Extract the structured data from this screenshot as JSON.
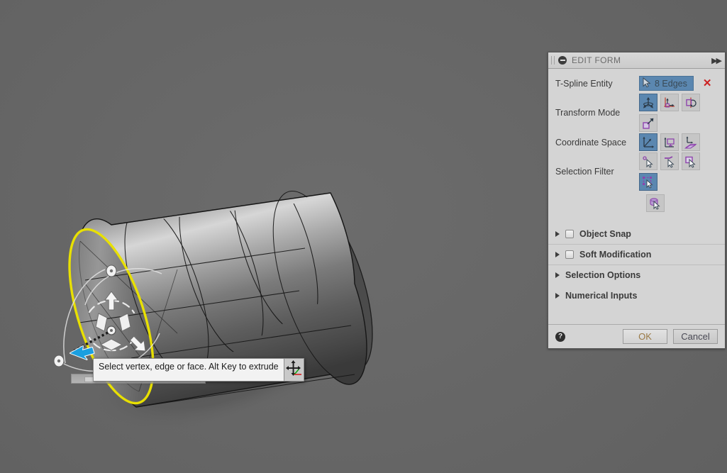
{
  "viewport": {
    "name": "3d-viewport",
    "background_color": "#666666",
    "model": {
      "name": "t-spline-cylinder",
      "highlight_color": "#e8e000",
      "surface_light": "#d8d8d8",
      "surface_dark": "#3c3c3c"
    },
    "manipulator": {
      "name": "transform-gizmo",
      "active_axis_color": "#1b9fe0"
    }
  },
  "tooltip": {
    "text": "Select vertex, edge or face. Alt Key to extrude",
    "cursor_icon": "move-cursor-icon"
  },
  "panel": {
    "title": "EDIT FORM",
    "collapse_icon": "collapse-circle-icon",
    "grip_icon": "drag-grip-icon",
    "expand_icon": "fast-forward-icon",
    "accent_color": "#5b87b0",
    "background_color": "#d4d4d4",
    "rows": [
      {
        "label": "T-Spline Entity",
        "selection_value": "8 Edges",
        "selection_icon": "select-cursor-icon",
        "clear_icon": "red-x-icon"
      },
      {
        "label": "Transform Mode",
        "options": [
          {
            "name": "transform-mode-all",
            "icon": "all-directions-icon",
            "active": true
          },
          {
            "name": "transform-mode-translate",
            "icon": "translate-icon",
            "active": false
          },
          {
            "name": "transform-mode-rotate",
            "icon": "rotate-icon",
            "active": false
          },
          {
            "name": "transform-mode-scale",
            "icon": "scale-icon",
            "active": false
          }
        ]
      },
      {
        "label": "Coordinate Space",
        "options": [
          {
            "name": "coordinate-space-world",
            "icon": "world-axes-icon",
            "active": true
          },
          {
            "name": "coordinate-space-view",
            "icon": "screen-icon",
            "active": false
          },
          {
            "name": "coordinate-space-surface",
            "icon": "surface-plane-icon",
            "active": false
          }
        ]
      },
      {
        "label": "Selection Filter",
        "options": [
          {
            "name": "selection-filter-vertex",
            "icon": "vertex-select-icon",
            "active": false
          },
          {
            "name": "selection-filter-edge",
            "icon": "edge-select-icon",
            "active": false
          },
          {
            "name": "selection-filter-face",
            "icon": "face-select-icon",
            "active": false
          },
          {
            "name": "selection-filter-body",
            "icon": "body-select-icon",
            "active": true
          },
          {
            "name": "selection-filter-object",
            "icon": "object-select-icon",
            "active": false
          }
        ]
      }
    ],
    "sections": [
      {
        "label": "Object Snap",
        "has_checkbox": true,
        "checked": false,
        "expanded": false
      },
      {
        "label": "Soft Modification",
        "has_checkbox": true,
        "checked": false,
        "expanded": false
      },
      {
        "label": "Selection Options",
        "has_checkbox": false,
        "checked": false,
        "expanded": false
      },
      {
        "label": "Numerical Inputs",
        "has_checkbox": false,
        "checked": false,
        "expanded": false
      }
    ],
    "footer": {
      "help_label": "?",
      "ok_label": "OK",
      "cancel_label": "Cancel"
    }
  }
}
